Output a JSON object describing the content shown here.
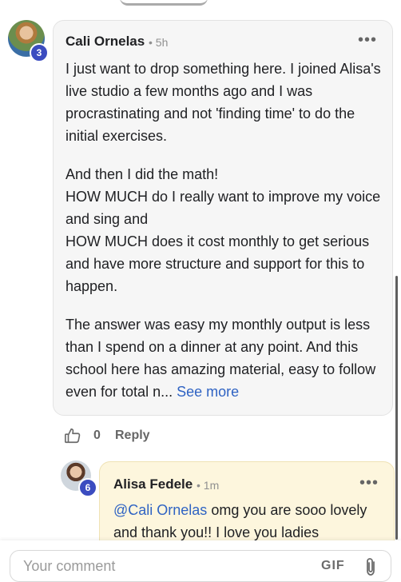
{
  "comment": {
    "author": "Cali Ornelas",
    "meta": "• 5h",
    "level": "3",
    "more_icon": "more-horizontal-icon",
    "paragraphs": [
      "I just want to drop something here. I joined Alisa's live studio a few months ago and I was procrastinating and not 'finding time' to do the initial exercises.",
      "And then I did the math!\nHOW MUCH do I really want to improve my voice and sing and\nHOW MUCH does it cost monthly to get serious and have more structure and support for this to happen.",
      "The answer was easy my monthly output is less than I spend on a dinner at any point. And this school here has amazing material, easy to follow even for total n... "
    ],
    "see_more": "See more",
    "like_count": "0",
    "reply_label": "Reply"
  },
  "reply": {
    "author": "Alisa Fedele",
    "meta": "• 1m",
    "level": "6",
    "mention": "@Cali Ornelas",
    "text": " omg you are sooo lovely and thank you!! I love you ladies"
  },
  "composer": {
    "placeholder": "Your comment",
    "gif_label": "GIF",
    "attach_icon": "paperclip-icon"
  },
  "colors": {
    "link": "#2f63c3",
    "level_badge": "#3b4cc0",
    "reply_bubble": "#fdf6dd",
    "comment_bubble": "#f6f6f6"
  }
}
